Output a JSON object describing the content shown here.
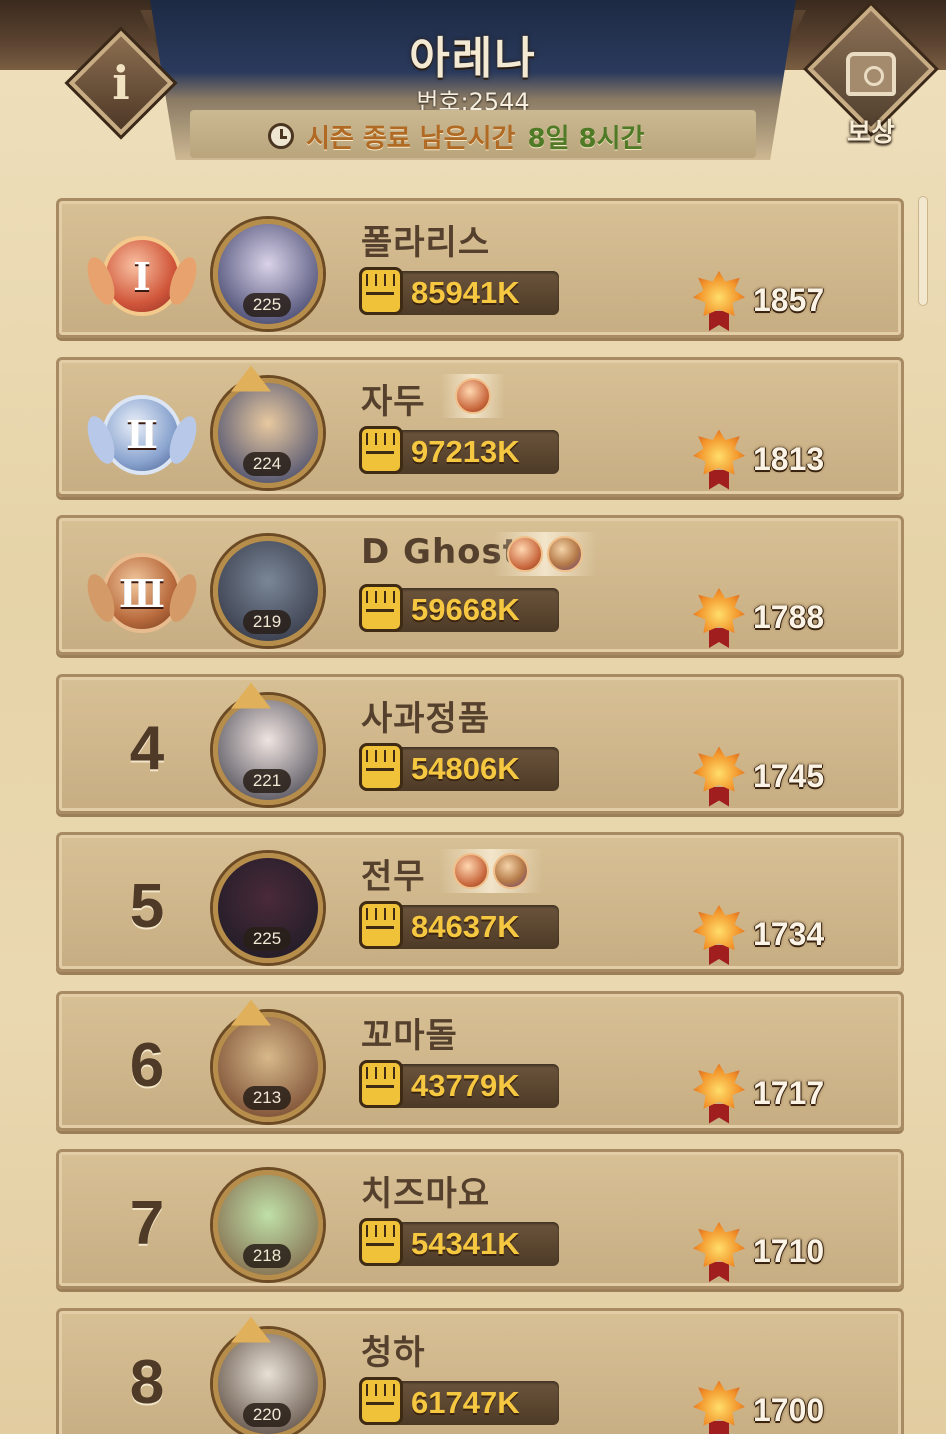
{
  "header": {
    "title": "아레나",
    "number_text": "번호:2544",
    "season_label": "시즌 종료 남은시간",
    "season_time": "8일 8시간",
    "info_label": "i",
    "reward_label": "보상"
  },
  "colors": {
    "header_navy": "#1d2a44",
    "card_bg": "#d8c095",
    "power_text": "#f6c741",
    "season_label": "#b06a24",
    "season_time": "#4f7a26"
  },
  "players": [
    {
      "rank": "1",
      "rank_medal": "Ⅰ",
      "medal_type": "gold",
      "name": "폴라리스",
      "level": "225",
      "power": "85941K",
      "trophies": "1857",
      "title_badges": []
    },
    {
      "rank": "2",
      "rank_medal": "Ⅱ",
      "medal_type": "silver",
      "name": "자두",
      "level": "224",
      "power": "97213K",
      "trophies": "1813",
      "title_badges": [
        "orange"
      ]
    },
    {
      "rank": "3",
      "rank_medal": "Ⅲ",
      "medal_type": "bronze",
      "name": "D Ghost",
      "level": "219",
      "power": "59668K",
      "trophies": "1788",
      "title_badges": [
        "orange",
        "purple"
      ]
    },
    {
      "rank": "4",
      "rank_medal": "",
      "medal_type": "",
      "name": "사과정품",
      "level": "221",
      "power": "54806K",
      "trophies": "1745",
      "title_badges": []
    },
    {
      "rank": "5",
      "rank_medal": "",
      "medal_type": "",
      "name": "전무",
      "level": "225",
      "power": "84637K",
      "trophies": "1734",
      "title_badges": [
        "orange",
        "purple"
      ]
    },
    {
      "rank": "6",
      "rank_medal": "",
      "medal_type": "",
      "name": "꼬마돌",
      "level": "213",
      "power": "43779K",
      "trophies": "1717",
      "title_badges": []
    },
    {
      "rank": "7",
      "rank_medal": "",
      "medal_type": "",
      "name": "치즈마요",
      "level": "218",
      "power": "54341K",
      "trophies": "1710",
      "title_badges": []
    },
    {
      "rank": "8",
      "rank_medal": "",
      "medal_type": "",
      "name": "청하",
      "level": "220",
      "power": "61747K",
      "trophies": "1700",
      "title_badges": []
    }
  ]
}
